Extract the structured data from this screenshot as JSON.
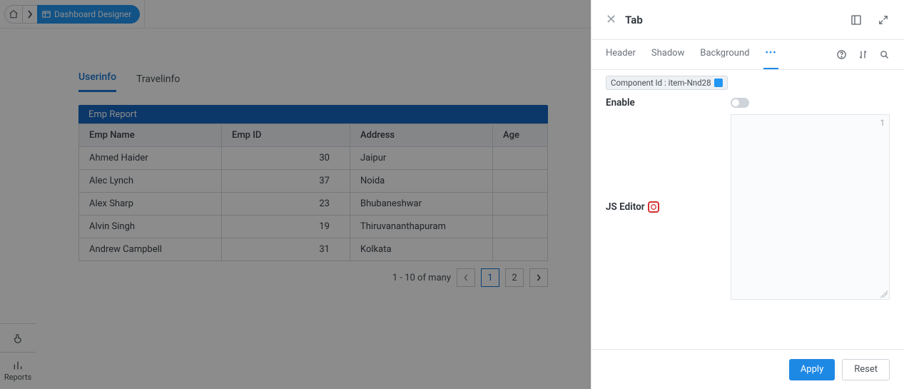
{
  "breadcrumb": {
    "title": "Dashboard Designer"
  },
  "sideRail": {
    "reports": "Reports"
  },
  "mainTabs": [
    "Userinfo",
    "Travelinfo"
  ],
  "report": {
    "title": "Emp Report",
    "columns": [
      "Emp Name",
      "Emp ID",
      "Address",
      "Age"
    ],
    "rows": [
      {
        "name": "Ahmed Haider",
        "id": "30",
        "address": "Jaipur"
      },
      {
        "name": "Alec Lynch",
        "id": "37",
        "address": "Noida"
      },
      {
        "name": "Alex Sharp",
        "id": "23",
        "address": "Bhubaneshwar"
      },
      {
        "name": "Alvin Singh",
        "id": "19",
        "address": "Thiruvananthapuram"
      },
      {
        "name": "Andrew Campbell",
        "id": "31",
        "address": "Kolkata"
      }
    ],
    "pagination": {
      "range": "1 - 10 of many",
      "pages": [
        "1",
        "2"
      ]
    }
  },
  "panel": {
    "title": "Tab",
    "tabs": [
      "Header",
      "Shadow",
      "Background"
    ],
    "more": "•••",
    "componentIdLabel": "Component Id : item-Nnd28",
    "enableLabel": "Enable",
    "jsEditorLabel": "JS Editor",
    "editorLineNumber": "1",
    "apply": "Apply",
    "reset": "Reset"
  }
}
